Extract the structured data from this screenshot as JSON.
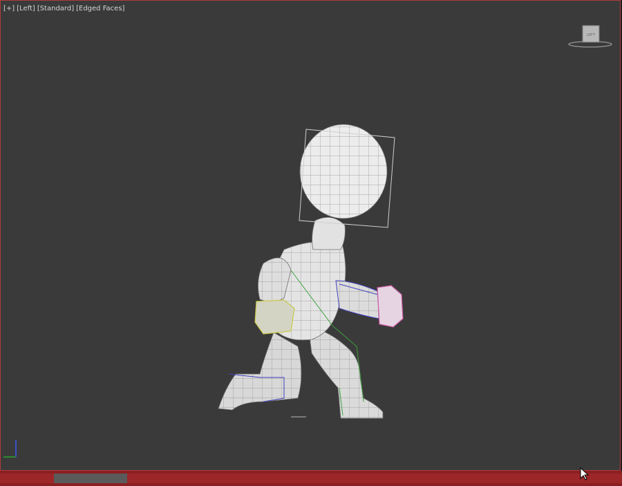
{
  "viewport": {
    "label_plus": "[+]",
    "label_view": "[Left]",
    "label_shading": "[Standard]",
    "label_display": "[Edged Faces]",
    "background": "#3a3a3a",
    "border_color": "#b33a3a"
  },
  "viewcube": {
    "face_label": "LEFT"
  },
  "timeline": {
    "color": "#8b1f22"
  },
  "icons": [
    "viewcube-icon",
    "axis-tripod-icon",
    "mouse-cursor-icon"
  ]
}
